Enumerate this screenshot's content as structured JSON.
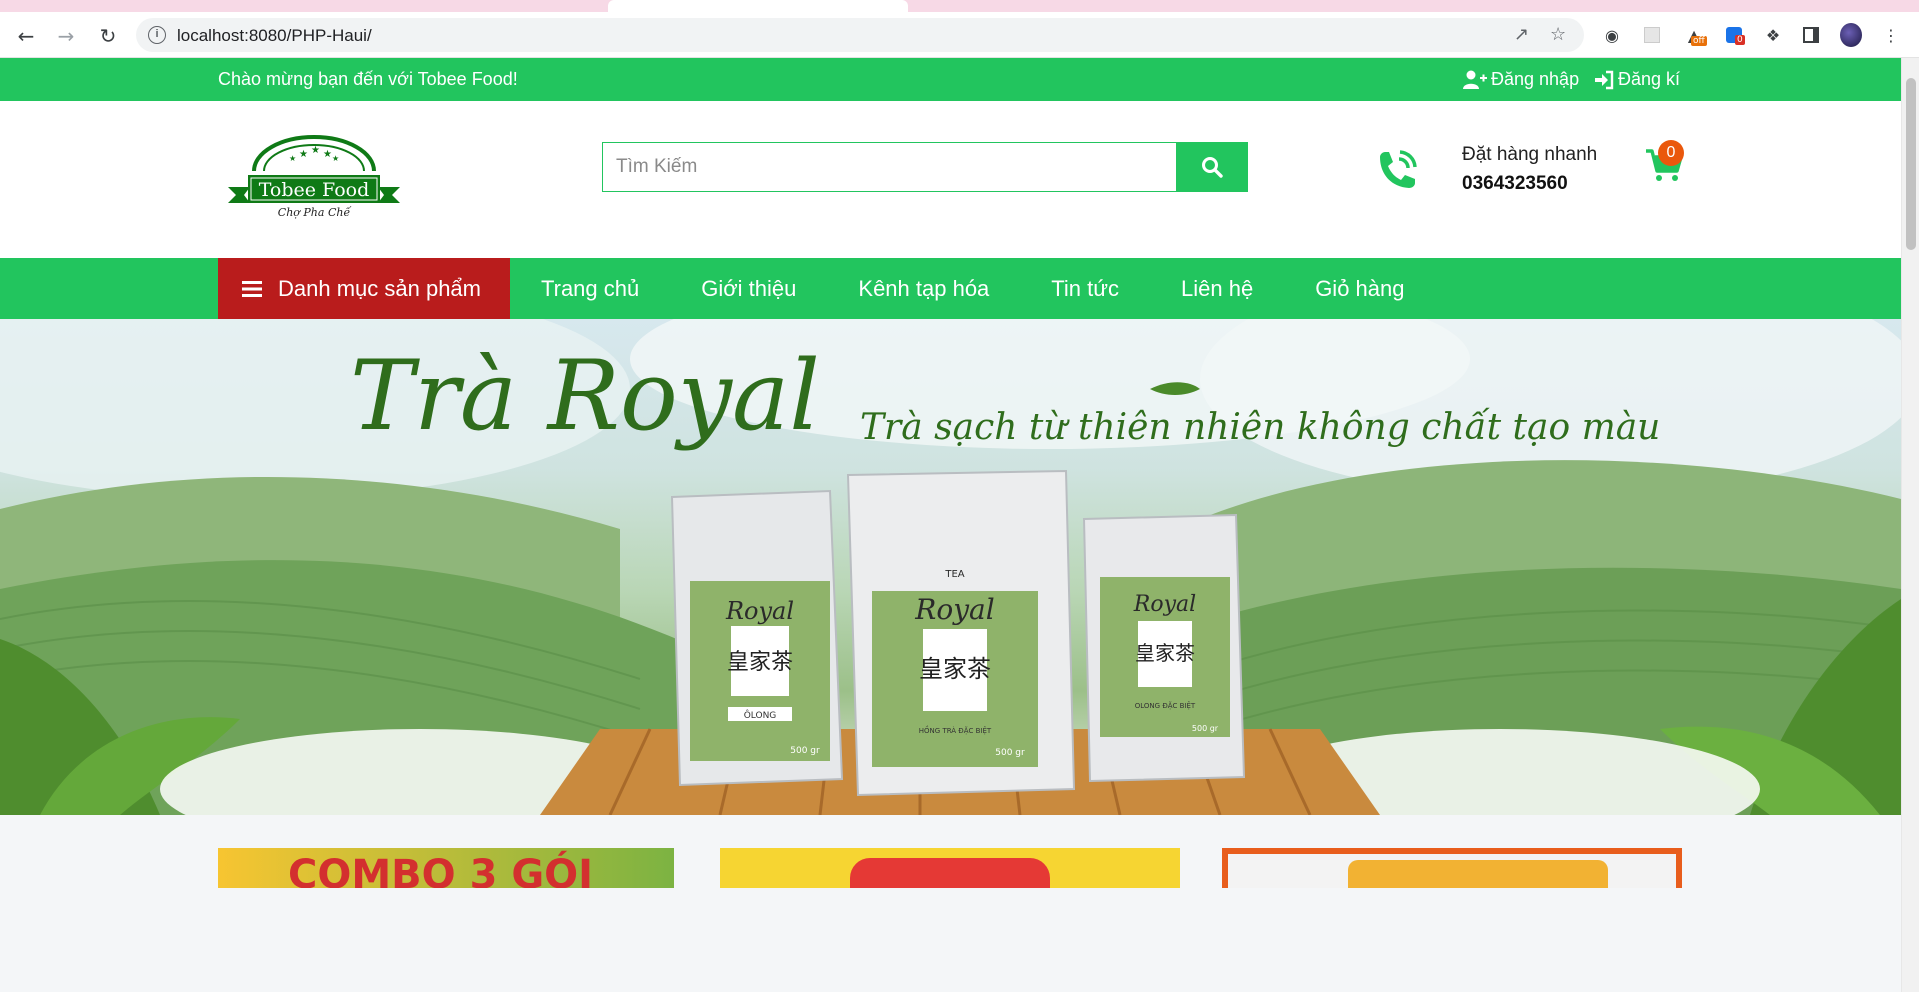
{
  "browser": {
    "url": "localhost:8080/PHP-Haui/",
    "ext_badge_off": "off",
    "ext_badge_count": "0"
  },
  "topbar": {
    "welcome": "Chào mừng bạn đến với Tobee Food!",
    "login": "Đăng nhập",
    "register": "Đăng kí"
  },
  "logo": {
    "brand": "Tobee Food",
    "tagline": "Chợ Pha Chế"
  },
  "search": {
    "placeholder": "Tìm Kiếm"
  },
  "contact": {
    "label": "Đặt hàng nhanh",
    "phone": "0364323560"
  },
  "cart": {
    "count": "0"
  },
  "nav": {
    "categories": "Danh mục sản phẩm",
    "items": [
      "Trang chủ",
      "Giới thiệu",
      "Kênh tạp hóa",
      "Tin tức",
      "Liên hệ",
      "Giỏ hàng"
    ]
  },
  "hero": {
    "title": "Trà Royal",
    "subtitle": "Trà sạch từ thiên nhiên không chất tạo màu",
    "bag_brand": "Royal",
    "bag_tea": "TEA",
    "bag_hanzi": "皇家茶",
    "bag_labels": [
      "ÔLONG",
      "HỒNG TRÀ ĐẶC BIỆT",
      "OLONG ĐẶC BIỆT"
    ],
    "bag_weight": "500 gr"
  },
  "promos": [
    "COMBO 3 GÓI"
  ],
  "colors": {
    "primary": "#22c55e",
    "category_bg": "#b91c1c",
    "cart_badge": "#ea580c"
  }
}
